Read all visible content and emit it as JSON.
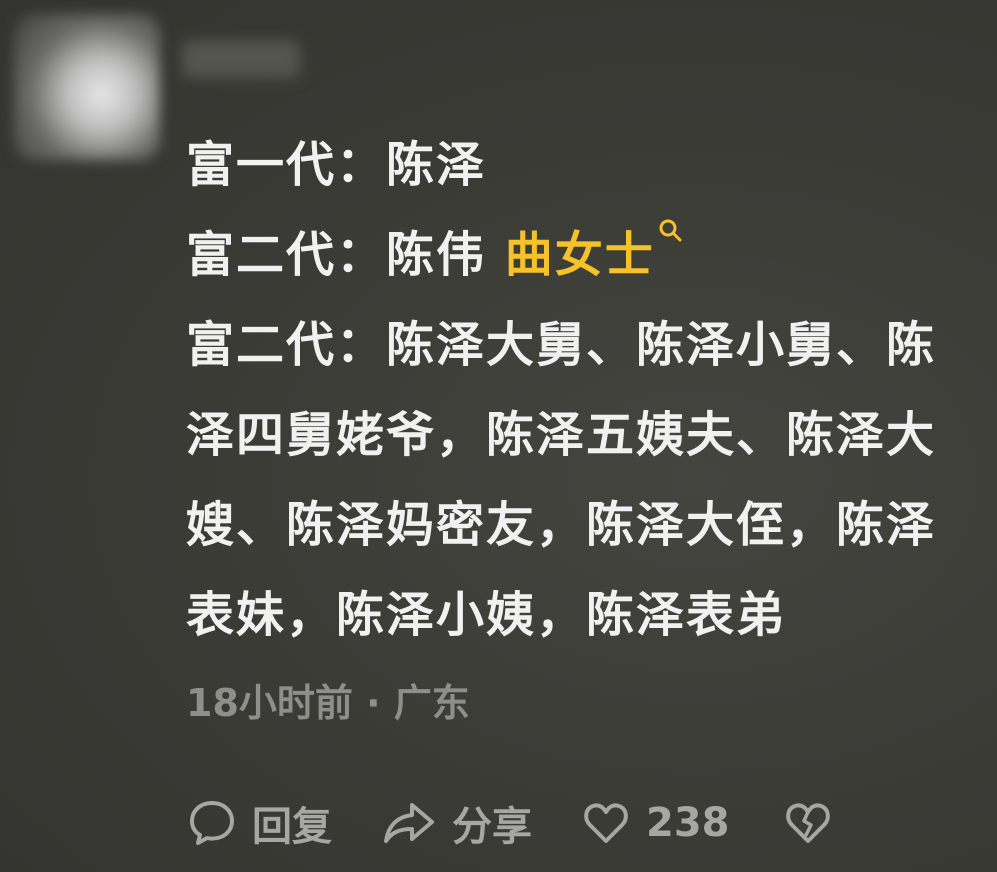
{
  "comment": {
    "lines": [
      {
        "text": "富一代：陈泽"
      },
      {
        "text": "富二代：陈伟 ",
        "mention": "曲女士"
      },
      {
        "text": "富二代：陈泽大舅、陈泽小舅、陈"
      },
      {
        "text": "泽四舅姥爷，陈泽五姨夫、陈泽大"
      },
      {
        "text": "嫂、陈泽妈密友，陈泽大侄，陈泽"
      },
      {
        "text": "表妹，陈泽小姨，陈泽表弟"
      }
    ],
    "meta": "18小时前 · 广东"
  },
  "actions": {
    "reply_label": "回复",
    "share_label": "分享",
    "like_count": "238"
  },
  "colors": {
    "mention": "#f5c22a",
    "text": "#f1f1f1",
    "muted": "#8e8e8a"
  }
}
